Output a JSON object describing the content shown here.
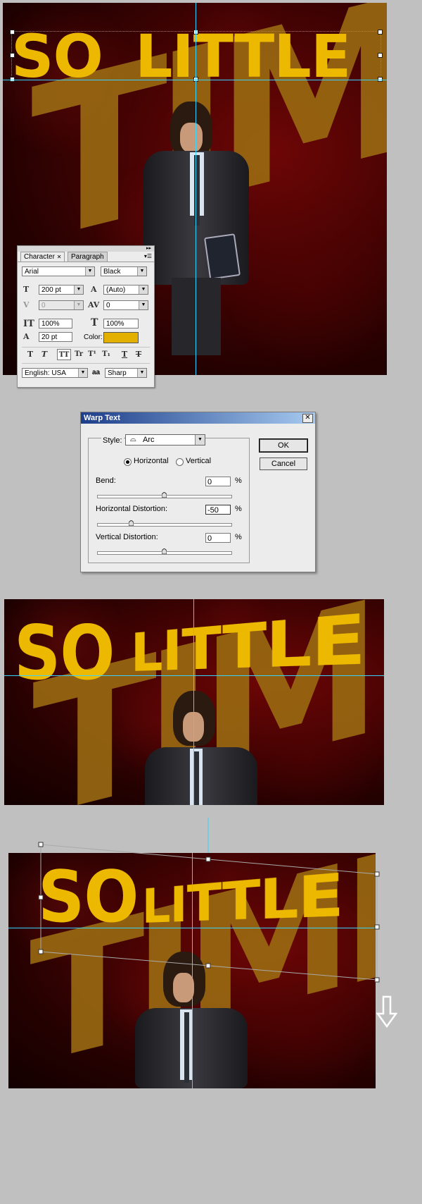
{
  "headline": {
    "so": "SO",
    "little": "LITTLE"
  },
  "background_word": "TIME",
  "character_panel": {
    "tabs": [
      "Character",
      "Paragraph"
    ],
    "font_family": "Arial",
    "font_style": "Black",
    "font_size": "200 pt",
    "leading": "(Auto)",
    "kerning": "0",
    "tracking": "0",
    "vertical_scale": "100%",
    "horizontal_scale": "100%",
    "baseline_shift": "20 pt",
    "color_label": "Color:",
    "color_value": "#e3b000",
    "style_buttons": [
      "T",
      "T",
      "TT",
      "Tr",
      "T¹",
      "T₁",
      "T",
      "T"
    ],
    "language": "English: USA",
    "antialias_icon": "aa",
    "antialias": "Sharp"
  },
  "warp_dialog": {
    "title": "Warp Text",
    "close": "✕",
    "style_label": "Style:",
    "style_value": "Arc",
    "orientation_horizontal": "Horizontal",
    "orientation_vertical": "Vertical",
    "bend_label": "Bend:",
    "bend_value": "0",
    "horizontal_distortion_label": "Horizontal Distortion:",
    "horizontal_distortion_value": "-50",
    "vertical_distortion_label": "Vertical Distortion:",
    "vertical_distortion_value": "0",
    "percent": "%",
    "ok": "OK",
    "cancel": "Cancel"
  },
  "colors": {
    "headline": "#ecb900",
    "guide": "#36d4ff",
    "background_red": "#4a0303"
  }
}
